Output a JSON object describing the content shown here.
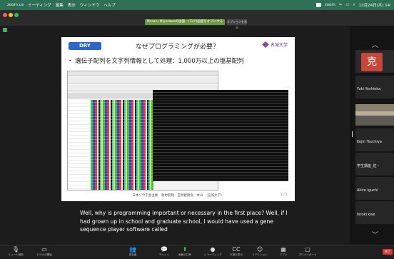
{
  "menubar": {
    "app": "zoom.us",
    "items": [
      "ミーティング",
      "編集",
      "表示",
      "ウィンドウ",
      "ヘルプ"
    ],
    "right_text": "zoom",
    "clock": "11月24日(木) 14:"
  },
  "titlebar": {
    "banner_text": "Masaru Miyazawaの画面、(ログ)画面をオフにする",
    "banner_button": "オプションを表示"
  },
  "slide": {
    "badge": "DRY",
    "title": "なぜプログラミングが必要？",
    "university": "名城大学",
    "bullet": "・ 遺伝子配列を文字列情報として処理：1,000万以上の塩基配列",
    "footer": "日本ゾウ学会主催　教材開発　自然観察会　本山　（名城大学）",
    "page": "1 / 1"
  },
  "caption": {
    "text": "Well, why is programming important or necessary in the first place? Well, if I had grown up in school and graduate school, I would have used a gene sequence player software called"
  },
  "participants": {
    "avatar_letter": "克",
    "names": [
      "Yuki Yoshioka",
      "Kojin Tsuchiya",
      "学生講座_佐・",
      "Akira Iguchi",
      "hiroki kise"
    ]
  },
  "toolbar": {
    "items": [
      {
        "icon": "mic-icon",
        "glyph": "🎙",
        "label": "ミュート解除"
      },
      {
        "icon": "video-icon",
        "glyph": "▭",
        "label": "ビデオの開始"
      },
      {
        "icon": "participants-icon",
        "glyph": "👥",
        "label": "参加者"
      },
      {
        "icon": "chat-icon",
        "glyph": "💬",
        "label": "チャット"
      },
      {
        "icon": "share-icon",
        "glyph": "⬆",
        "label": "画面の共有"
      },
      {
        "icon": "record-icon",
        "glyph": "●",
        "label": "レコーディング"
      },
      {
        "icon": "caption-icon",
        "glyph": "CC",
        "label": "字幕を表示"
      },
      {
        "icon": "reactions-icon",
        "glyph": "☺",
        "label": "リアクション"
      },
      {
        "icon": "apps-icon",
        "glyph": "▦",
        "label": "アプリ"
      },
      {
        "icon": "whiteboard-icon",
        "glyph": "▢",
        "label": "ホワイトボード"
      }
    ],
    "end_label": "終了"
  },
  "colors": {
    "menubar": "#2e6f56",
    "banner": "#6a9a3c",
    "dry_badge": "#2f65c7",
    "avatar": "#c7473a",
    "end_button": "#dd3333"
  }
}
